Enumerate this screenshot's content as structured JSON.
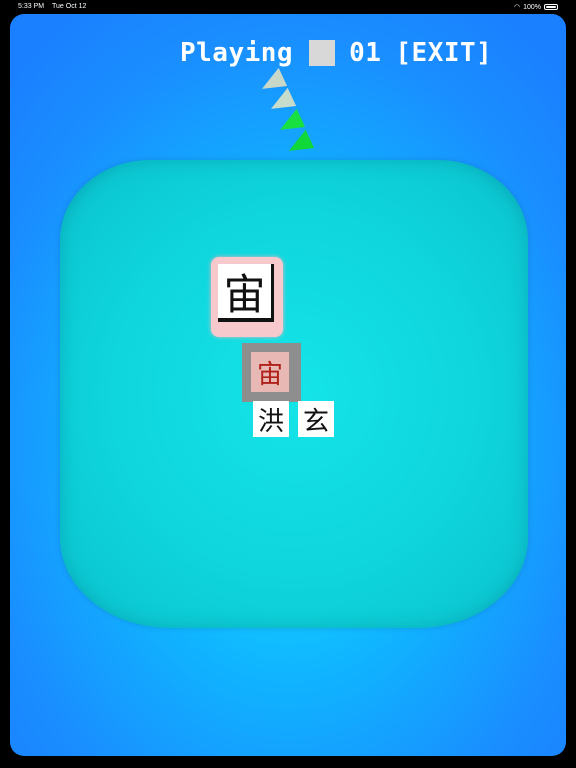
{
  "status_bar": {
    "time": "5:33 PM",
    "date": "Tue Oct 12",
    "battery": "100%"
  },
  "header": {
    "status": "Playing",
    "counter": "01",
    "exit_label": "[EXIT]"
  },
  "colors": {
    "background_blue": "#1a8dff",
    "board_cyan": "#0fd5dc",
    "arrow_gray": "#c8d8c8",
    "arrow_green": "#18e040",
    "selected_tile_text": "#b0201a"
  },
  "tiles": {
    "featured": "宙",
    "selected": "宙",
    "row": [
      "洪",
      "玄"
    ]
  }
}
